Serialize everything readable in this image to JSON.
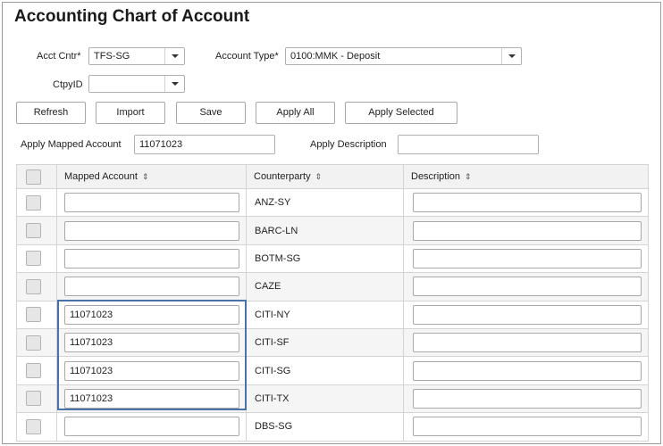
{
  "page": {
    "title": "Accounting Chart of Account"
  },
  "filters": {
    "acct_cntr_label": "Acct Cntr*",
    "acct_cntr_value": "TFS-SG",
    "account_type_label": "Account Type*",
    "account_type_value": "0100:MMK - Deposit",
    "ctpy_label": "CtpyID",
    "ctpy_value": ""
  },
  "toolbar": {
    "refresh": "Refresh",
    "import": "Import",
    "save": "Save",
    "apply_all": "Apply All",
    "apply_selected": "Apply Selected"
  },
  "apply": {
    "mapped_label": "Apply Mapped Account",
    "mapped_value": "11071023",
    "desc_label": "Apply Description",
    "desc_value": ""
  },
  "table": {
    "columns": [
      "Mapped Account",
      "Counterparty",
      "Description"
    ],
    "sort_icon": "sort-icon",
    "rows": [
      {
        "mapped": "",
        "counterparty": "ANZ-SY",
        "description": ""
      },
      {
        "mapped": "",
        "counterparty": "BARC-LN",
        "description": ""
      },
      {
        "mapped": "",
        "counterparty": "BOTM-SG",
        "description": ""
      },
      {
        "mapped": "",
        "counterparty": "CAZE",
        "description": ""
      },
      {
        "mapped": "11071023",
        "counterparty": "CITI-NY",
        "description": ""
      },
      {
        "mapped": "11071023",
        "counterparty": "CITI-SF",
        "description": ""
      },
      {
        "mapped": "11071023",
        "counterparty": "CITI-SG",
        "description": ""
      },
      {
        "mapped": "11071023",
        "counterparty": "CITI-TX",
        "description": ""
      },
      {
        "mapped": "",
        "counterparty": "DBS-SG",
        "description": ""
      }
    ]
  },
  "colors": {
    "highlight": "#4a72a8"
  }
}
